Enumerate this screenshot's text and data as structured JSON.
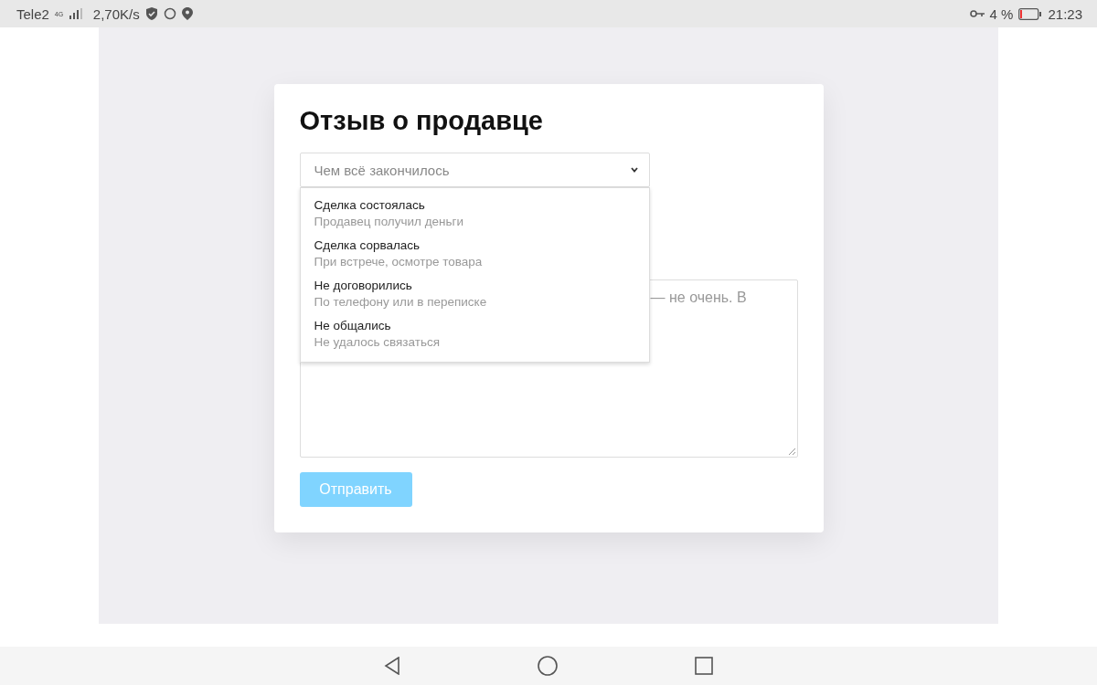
{
  "status_bar": {
    "carrier": "Tele2",
    "network": "4G",
    "speed": "2,70K/s",
    "battery": "4 %",
    "time": "21:23"
  },
  "card": {
    "title": "Отзыв о продавце",
    "select": {
      "placeholder": "Чем всё закончилось",
      "expanded": true,
      "options": [
        {
          "label": "Сделка состоялась",
          "hint": "Продавец получил деньги"
        },
        {
          "label": "Сделка сорвалась",
          "hint": "При встрече, осмотре товара"
        },
        {
          "label": "Не договорились",
          "hint": "По телефону или в переписке"
        },
        {
          "label": "Не общались",
          "hint": "Не удалось связаться"
        }
      ]
    },
    "textarea": {
      "placeholder": "— не очень. В"
    },
    "submit": {
      "label": "Отправить",
      "disabled": true
    }
  }
}
